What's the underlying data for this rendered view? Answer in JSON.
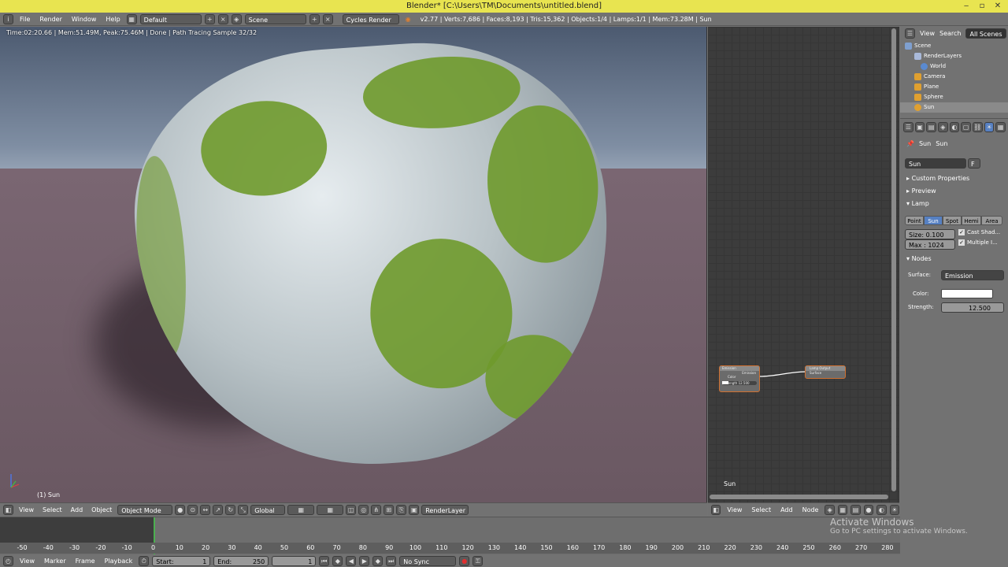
{
  "window": {
    "title": "Blender* [C:\\Users\\TM\\Documents\\untitled.blend]"
  },
  "info_header": {
    "menu": [
      "File",
      "Render",
      "Window",
      "Help"
    ],
    "layout": "Default",
    "scene": "Scene",
    "engine": "Cycles Render",
    "stats": "v2.77 | Verts:7,686 | Faces:8,193 | Tris:15,362 | Objects:1/4 | Lamps:1/1 | Mem:73.28M | Sun"
  },
  "viewport": {
    "status": "Time:02:20.66 | Mem:51.49M, Peak:75.46M | Done | Path Tracing Sample 32/32",
    "object_label": "(1) Sun",
    "header": {
      "menu": [
        "View",
        "Select",
        "Add",
        "Object"
      ],
      "mode": "Object Mode",
      "orientation": "Global",
      "layer": "RenderLayer"
    }
  },
  "node_editor": {
    "label": "Sun",
    "nodes": {
      "emission": {
        "title": "Emission",
        "output": "Emission",
        "color_label": "Color",
        "strength": "Strength 12.500"
      },
      "output": {
        "title": "Lamp Output",
        "input": "Surface"
      }
    },
    "header": {
      "menu": [
        "View",
        "Select",
        "Add",
        "Node"
      ]
    }
  },
  "outliner": {
    "header": {
      "view": "View",
      "search": "Search",
      "filter": "All Scenes"
    },
    "items": [
      {
        "label": "Scene",
        "color": "#7fa0d0"
      },
      {
        "label": "RenderLayers",
        "color": "#a9b9d9"
      },
      {
        "label": "World",
        "color": "#5a8ad0"
      },
      {
        "label": "Camera",
        "color": "#e0a030"
      },
      {
        "label": "Plane",
        "color": "#e0a030"
      },
      {
        "label": "Sphere",
        "color": "#e0a030"
      },
      {
        "label": "Sun",
        "color": "#e0a030"
      }
    ]
  },
  "properties": {
    "breadcrumb": [
      "Sun",
      "Sun"
    ],
    "datablock": "Sun",
    "datablock_flag": "F",
    "panels": {
      "custom": "Custom Properties",
      "preview": "Preview",
      "lamp": "Lamp",
      "nodes": "Nodes"
    },
    "lamp_types": [
      "Point",
      "Sun",
      "Spot",
      "Hemi",
      "Area"
    ],
    "active_lamp_type": "Sun",
    "size": "Size: 0.100",
    "max": "Max : 1024",
    "cast_shadow": "Cast Shad...",
    "multiple_importance": "Multiple I...",
    "surface_label": "Surface:",
    "surface_value": "Emission",
    "color_label": "Color:",
    "color_value": "#ffffff",
    "strength_label": "Strength:",
    "strength_value": "12.500"
  },
  "timeline": {
    "ticks": [
      "-50",
      "-40",
      "-30",
      "-20",
      "-10",
      "0",
      "10",
      "20",
      "30",
      "40",
      "50",
      "60",
      "70",
      "80",
      "90",
      "100",
      "110",
      "120",
      "130",
      "140",
      "150",
      "160",
      "170",
      "180",
      "190",
      "200",
      "210",
      "220",
      "230",
      "240",
      "250",
      "260",
      "270",
      "280"
    ],
    "header": {
      "menu": [
        "View",
        "Marker",
        "Frame",
        "Playback"
      ],
      "start_label": "Start:",
      "start": "1",
      "end_label": "End:",
      "end": "250",
      "current": "1",
      "sync": "No Sync"
    }
  },
  "watermark": {
    "title": "Activate Windows",
    "subtitle": "Go to PC settings to activate Windows."
  }
}
